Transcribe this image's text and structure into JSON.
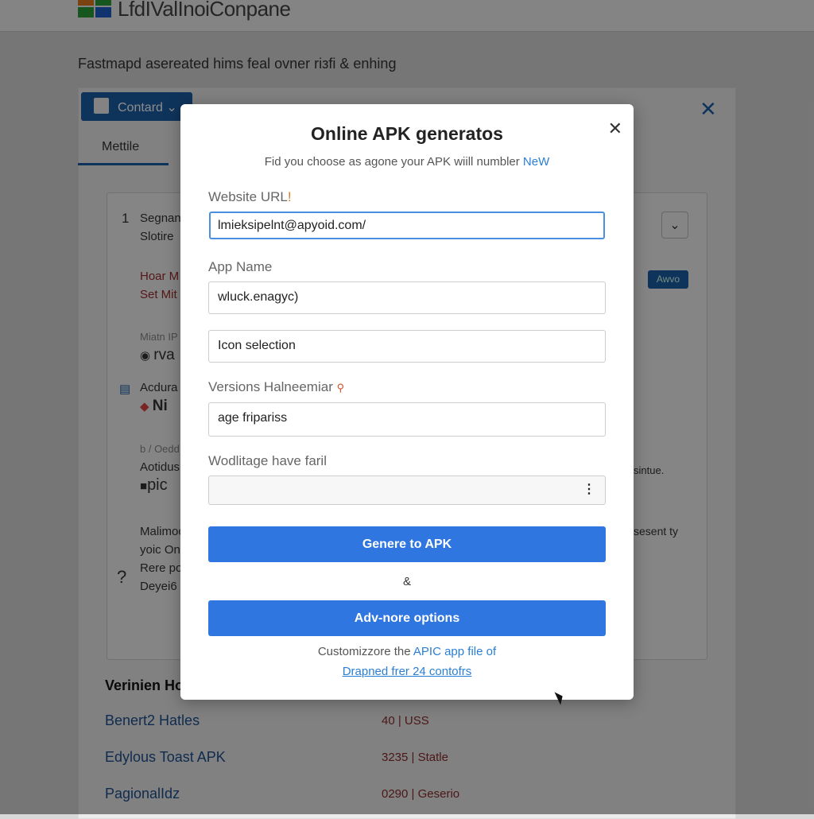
{
  "header": {
    "brand": "LfdIValInoiConpane",
    "logo_colors": [
      "#e07a1f",
      "#2a9d3a",
      "#1f5fc9",
      "#d6338a"
    ]
  },
  "tagline": "Fastmapd asereated hims feal ovner riзfi & enhing",
  "toolbar": {
    "contard_label": "Contard",
    "tab_label": "Mettile"
  },
  "background_list": {
    "items": [
      {
        "num": "1",
        "line1": "Segnan",
        "line2": "Slotire"
      },
      {
        "line1": "Hoar M",
        "line2": "Set Mit"
      },
      {
        "line1": "Miatn IP",
        "line2": "rva"
      },
      {
        "line1": "Acdura",
        "line2": "Ni"
      },
      {
        "line1": "b / Oedd",
        "line2": "Aotidus",
        "line3": "pic"
      },
      {
        "line1": "Malimoc",
        "line2": "yoic Onl"
      },
      {
        "line1": "Rere por",
        "line2": "Deyei6 h"
      }
    ],
    "badge": "Awvo",
    "right_text_1": "sintue.",
    "right_text_2": "sesent ty"
  },
  "versions": {
    "heading": "Verinien Ho",
    "rows": [
      {
        "name": "Benert2 Hatles",
        "value": "40 | USS"
      },
      {
        "name": "Edylous Toast APK",
        "value": "3235 | Statle"
      },
      {
        "name": "PagionalIdz",
        "value": "0290 | Geserio"
      }
    ]
  },
  "modal": {
    "title": "Online APK generatos",
    "subtitle": "Fid you choose as agone your APK wiill numbler",
    "subtitle_link": "NeW",
    "url_label": "Website URL",
    "url_value": "lmieksipelnt@apyoid.com/",
    "app_name_label": "App Name",
    "app_name_value": "wluck.enagyc)",
    "icon_value": "Icon selection",
    "version_label": "Versions Halneemiar",
    "version_value": "age fripariss",
    "wod_label": "Wodlitage have faril",
    "wod_value": "",
    "generate_button": "Genere to APK",
    "amp": "&",
    "advanced_button": "Adv-nore options",
    "footer_text": "Customizzore the",
    "footer_link": "APIC app file of",
    "footer_link2": "Drapned frer 24 contofrs"
  },
  "colors": {
    "accent": "#2f76e0",
    "brand_blue": "#1d5fa8"
  }
}
